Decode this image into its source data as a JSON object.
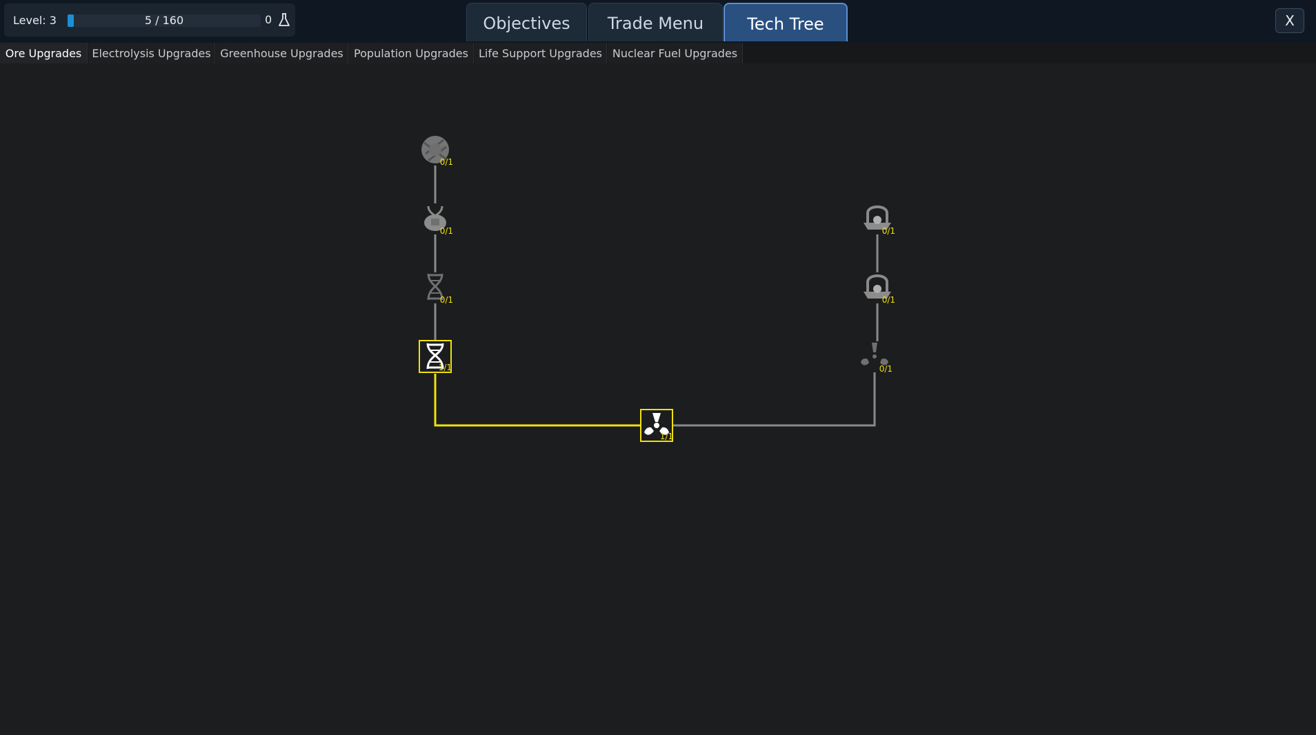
{
  "hud": {
    "level_label": "Level: 3",
    "xp_text": "5 / 160",
    "xp_progress": 0.031,
    "research_points": "0",
    "research_icon": "flask-icon"
  },
  "main_tabs": [
    {
      "label": "Objectives",
      "active": false
    },
    {
      "label": "Trade Menu",
      "active": false
    },
    {
      "label": "Tech Tree",
      "active": true
    }
  ],
  "close_label": "X",
  "sub_tabs": [
    {
      "label": "Ore Upgrades",
      "active": true
    },
    {
      "label": "Electrolysis Upgrades",
      "active": false
    },
    {
      "label": "Greenhouse Upgrades",
      "active": false
    },
    {
      "label": "Population Upgrades",
      "active": false
    },
    {
      "label": "Life Support Upgrades",
      "active": false
    },
    {
      "label": "Nuclear Fuel Upgrades",
      "active": false
    }
  ],
  "colors": {
    "owned": "#f0e10e",
    "locked_link": "#8a8a8a",
    "accent": "#2a5080"
  },
  "tree": {
    "nodes": [
      {
        "id": "mutation-icon",
        "count": "0/1",
        "owned": false
      },
      {
        "id": "gene-lock-icon",
        "count": "0/1",
        "owned": false
      },
      {
        "id": "dna-dim-icon",
        "count": "0/1",
        "owned": false
      },
      {
        "id": "dna-icon",
        "count": "1/1",
        "owned": true
      },
      {
        "id": "radiation-icon",
        "count": "1/1",
        "owned": true
      },
      {
        "id": "shielded-radiation-icon-1",
        "count": "0/1",
        "owned": false
      },
      {
        "id": "shielded-radiation-icon-2",
        "count": "0/1",
        "owned": false
      },
      {
        "id": "radiation-dim-icon",
        "count": "0/1",
        "owned": false
      }
    ]
  }
}
